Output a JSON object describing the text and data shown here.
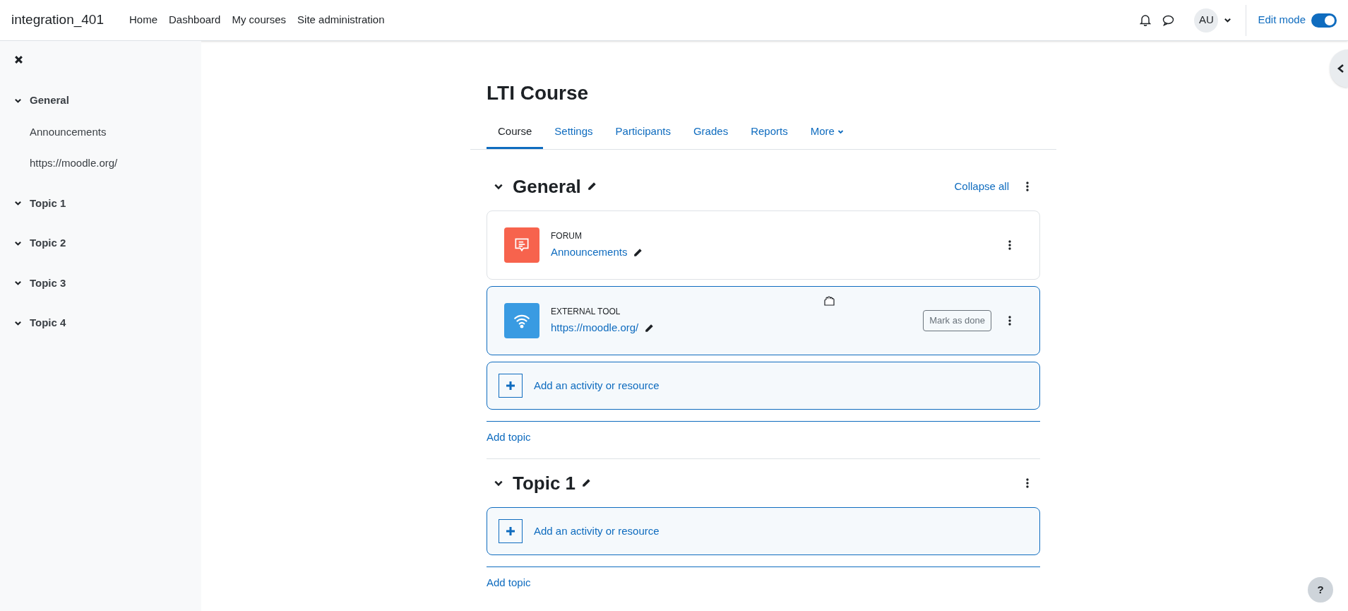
{
  "navbar": {
    "site_name": "integration_401",
    "links": [
      "Home",
      "Dashboard",
      "My courses",
      "Site administration"
    ],
    "user_initials": "AU",
    "edit_mode": {
      "label": "Edit mode",
      "on": true
    }
  },
  "course_index": {
    "sections": [
      {
        "title": "General",
        "expanded": true,
        "children": [
          {
            "label": "Announcements"
          },
          {
            "label": "https://moodle.org/"
          }
        ]
      },
      {
        "title": "Topic 1",
        "expanded": true
      },
      {
        "title": "Topic 2",
        "expanded": true
      },
      {
        "title": "Topic 3",
        "expanded": true
      },
      {
        "title": "Topic 4",
        "expanded": true
      }
    ]
  },
  "course": {
    "title": "LTI Course",
    "tabs": [
      {
        "label": "Course",
        "selected": true,
        "kind": "link"
      },
      {
        "label": "Settings",
        "selected": false,
        "kind": "link"
      },
      {
        "label": "Participants",
        "selected": false,
        "kind": "link"
      },
      {
        "label": "Grades",
        "selected": false,
        "kind": "link"
      },
      {
        "label": "Reports",
        "selected": false,
        "kind": "link"
      },
      {
        "label": "More",
        "selected": false,
        "kind": "dropdown"
      }
    ],
    "sections": [
      {
        "title": "General",
        "collapse_all": "Collapse all",
        "activities": [
          {
            "kind": "forum",
            "type_label": "FORUM",
            "name": "Announcements",
            "highlighted": false
          },
          {
            "kind": "external_tool",
            "type_label": "EXTERNAL TOOL",
            "name": "https://moodle.org/",
            "highlighted": true,
            "completion_button": "Mark as done"
          }
        ],
        "add_activity": "Add an activity or resource",
        "add_topic": "Add topic"
      },
      {
        "title": "Topic 1",
        "add_activity": "Add an activity or resource",
        "add_topic": "Add topic"
      }
    ]
  },
  "help_button": "?"
}
